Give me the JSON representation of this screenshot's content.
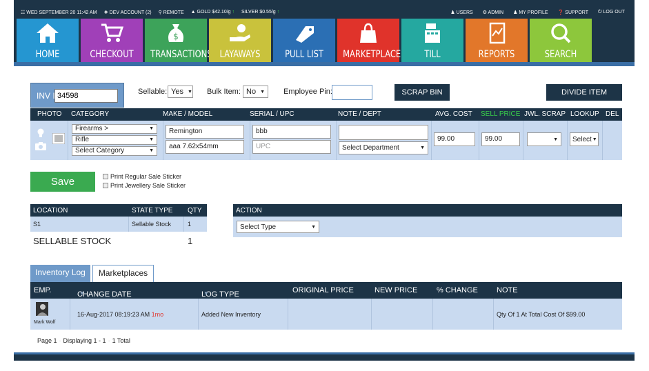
{
  "topbar": {
    "date": "WED SEPTEMBER 20",
    "time": "11:42 AM",
    "account": "DEV ACCOUNT (2)",
    "location": "REMOTE",
    "gold": "GOLD $42.10/g",
    "silver": "SILVER $0.55/g",
    "links": [
      "USERS",
      "ADMIN",
      "MY PROFILE",
      "SUPPORT",
      "LOG OUT"
    ]
  },
  "nav": [
    {
      "label": "HOME",
      "color": "#2596d1",
      "icon": "home-icon"
    },
    {
      "label": "CHECKOUT",
      "color": "#a040b8",
      "icon": "cart-icon"
    },
    {
      "label": "TRANSACTIONS",
      "color": "#3da35a",
      "icon": "money-bag-icon"
    },
    {
      "label": "LAYAWAYS",
      "color": "#c9c23c",
      "icon": "hand-coin-icon"
    },
    {
      "label": "PULL LIST",
      "color": "#2b6fb4",
      "icon": "tag-icon"
    },
    {
      "label": "MARKETPLACE",
      "color": "#e0332b",
      "icon": "shopping-bag-icon"
    },
    {
      "label": "TILL",
      "color": "#25a8a0",
      "icon": "register-icon"
    },
    {
      "label": "REPORTS",
      "color": "#e2772a",
      "icon": "report-icon"
    },
    {
      "label": "SEARCH",
      "color": "#8dc73c",
      "icon": "search-icon"
    }
  ],
  "form": {
    "inv_label": "INV ID:",
    "inv_value": "34598",
    "sellable_label": "Sellable:",
    "sellable_value": "Yes",
    "bulk_label": "Bulk Item:",
    "bulk_value": "No",
    "employee_pin_label": "Employee Pin:",
    "scrap_bin": "SCRAP BIN",
    "divide_item": "DIVIDE ITEM"
  },
  "item_table": {
    "headers": {
      "photo": "PHOTO",
      "category": "CATEGORY",
      "make_model": "MAKE / MODEL",
      "serial": "SERIAL / UPC",
      "note": "NOTE / DEPT",
      "avg_cost": "AVG. COST",
      "sell_price": "SELL PRICE",
      "jwl_scrap": "JWL. SCRAP",
      "lookup": "LOOKUP",
      "del": "DEL"
    },
    "category1": "Firearms >",
    "category2": "Rifle",
    "category3": "Select Category",
    "make": "Remington",
    "model": "aaa 7.62x54mm",
    "serial": "bbb",
    "upc_placeholder": "UPC",
    "department": "Select Department",
    "avg_cost": "99.00",
    "sell_price": "99.00",
    "lookup": "Select"
  },
  "save": {
    "label": "Save",
    "print_regular": "Print Regular Sale Sticker",
    "print_jewellery": "Print Jewellery Sale Sticker"
  },
  "location_table": {
    "headers": {
      "location": "LOCATION",
      "state": "STATE TYPE",
      "qty": "QTY"
    },
    "row": {
      "location": "S1",
      "state": "Sellable Stock",
      "qty": "1"
    },
    "total_label": "SELLABLE STOCK",
    "total_qty": "1"
  },
  "action": {
    "header": "ACTION",
    "select": "Select Type"
  },
  "tabs": [
    "Inventory Log",
    "Marketplaces"
  ],
  "log": {
    "headers": {
      "emp": "EMP.",
      "date": "CHANGE DATE",
      "type": "LOG TYPE",
      "orig": "ORIGINAL PRICE",
      "new": "NEW PRICE",
      "change": "% CHANGE",
      "note": "NOTE"
    },
    "row": {
      "emp": "Mark Wolf",
      "date": "16-Aug-2017 08:19:23 AM",
      "age": "1mo",
      "type": "Added New Inventory",
      "note": "Qty Of 1 At Total Cost Of $99.00"
    },
    "pager": {
      "page": "Page 1",
      "displaying": "Displaying 1 - 1",
      "total": "1 Total"
    }
  }
}
